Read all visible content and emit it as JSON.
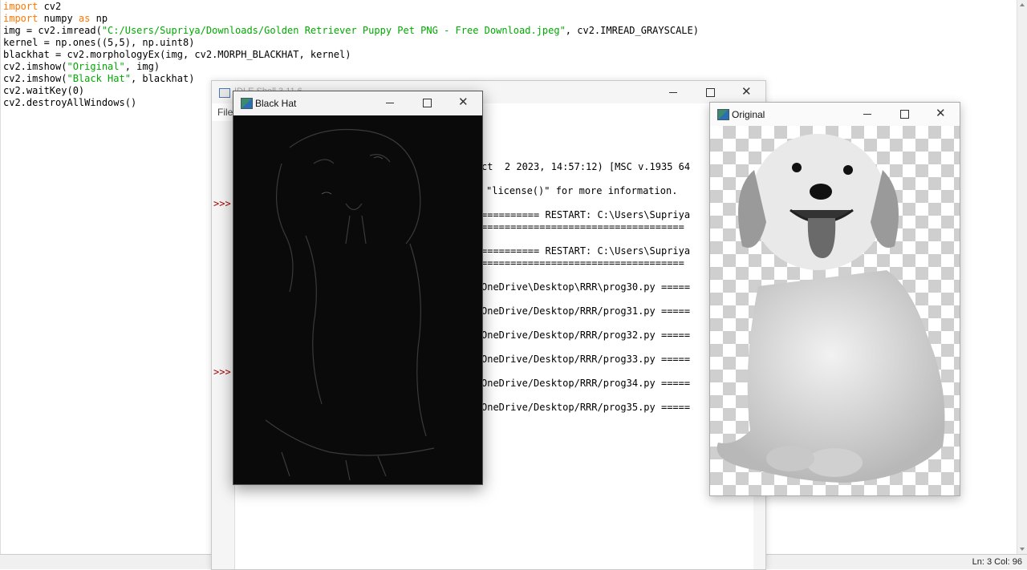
{
  "editor": {
    "lines": [
      [
        {
          "t": "import",
          "c": "kw"
        },
        {
          "t": " cv2",
          "c": ""
        }
      ],
      [
        {
          "t": "import",
          "c": "kw"
        },
        {
          "t": " numpy ",
          "c": ""
        },
        {
          "t": "as",
          "c": "kw"
        },
        {
          "t": " np",
          "c": ""
        }
      ],
      [
        {
          "t": "img = cv2.imread(",
          "c": ""
        },
        {
          "t": "\"C:/Users/Supriya/Downloads/Golden Retriever Puppy Pet PNG - Free Download.jpeg\"",
          "c": "str"
        },
        {
          "t": ", cv2.IMREAD_GRAYSCALE)",
          "c": ""
        }
      ],
      [
        {
          "t": "kernel = np.ones((5,5), np.uint8)",
          "c": ""
        }
      ],
      [
        {
          "t": "blackhat = cv2.morphologyEx(img, cv2.MORPH_BLACKHAT, kernel)",
          "c": ""
        }
      ],
      [
        {
          "t": "cv2.imshow(",
          "c": ""
        },
        {
          "t": "\"Original\"",
          "c": "str"
        },
        {
          "t": ", img)",
          "c": ""
        }
      ],
      [
        {
          "t": "cv2.imshow(",
          "c": ""
        },
        {
          "t": "\"Black Hat\"",
          "c": "str"
        },
        {
          "t": ", blackhat)",
          "c": ""
        }
      ],
      [
        {
          "t": "cv2.waitKey(0)",
          "c": ""
        }
      ],
      [
        {
          "t": "cv2.destroyAllWindows()",
          "c": ""
        }
      ]
    ]
  },
  "status": {
    "position": "Ln: 3   Col: 96"
  },
  "shell": {
    "title": "IDLE Shell 3.11.6",
    "menu_file": "File",
    "prompt": ">>>",
    "lines": [
      "ct  2 2023, 14:57:12) [MSC v.1935 64",
      "\"license()\" for more information.",
      "========== RESTART: C:\\Users\\Supriya",
      "===================================",
      "========== RESTART: C:\\Users\\Supriya",
      "===================================",
      "OneDrive\\Desktop\\RRR\\prog30.py =====",
      "OneDrive/Desktop/RRR/prog31.py =====",
      "OneDrive/Desktop/RRR/prog32.py =====",
      "OneDrive/Desktop/RRR/prog33.py =====",
      "OneDrive/Desktop/RRR/prog34.py =====",
      "OneDrive/Desktop/RRR/prog35.py ====="
    ]
  },
  "blackhat_window": {
    "title": "Black Hat"
  },
  "original_window": {
    "title": "Original"
  },
  "window_controls": {
    "minimize": "—",
    "maximize": "☐",
    "close": "✕"
  }
}
